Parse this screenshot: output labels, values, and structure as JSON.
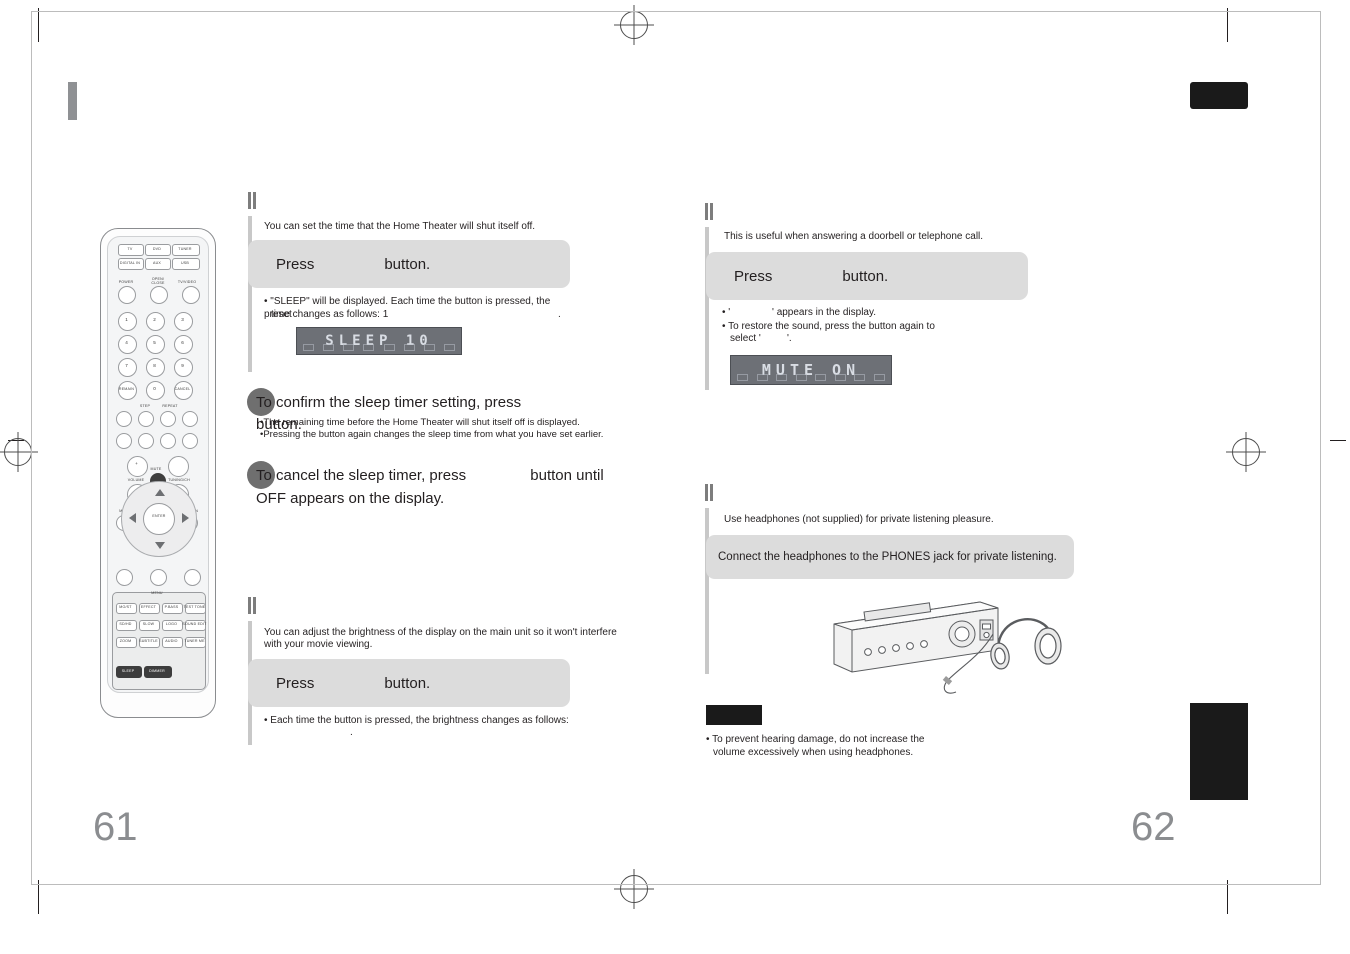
{
  "meta": {
    "left_page_number": "61",
    "right_page_number": "62"
  },
  "left_page": {
    "sleep_timer": {
      "intro": "You can set the time that the Home Theater will shut itself off.",
      "bar": {
        "press": "Press",
        "button": "button."
      },
      "bullets": [
        "• \"SLEEP\" will be displayed. Each time the button is pressed, the preset",
        "time changes as follows: 1",
        "."
      ],
      "display": {
        "text": "SLEEP 10"
      },
      "steps": [
        {
          "line1": "To confirm the sleep timer setting, press",
          "line2": "button.",
          "notes": [
            "•The remaining time before the Home Theater will shut itself off is displayed.",
            "•Pressing the button again changes the sleep time from what you have set earlier."
          ]
        },
        {
          "line1": "To cancel the sleep timer, press",
          "line2": "button until",
          "line3": "OFF appears on the display."
        }
      ]
    },
    "brightness": {
      "intro_line1": "You can adjust the brightness of the display on the main unit so it won't interfere",
      "intro_line2": "with your movie viewing.",
      "bar": {
        "press": "Press",
        "button": "button."
      },
      "bullet_line1": "• Each time the button is pressed, the brightness changes as follows:",
      "bullet_line2": "."
    }
  },
  "right_page": {
    "mute": {
      "intro": "This is useful when answering a doorbell or telephone call.",
      "bar": {
        "press": "Press",
        "button": "button."
      },
      "bullets": [
        "• '",
        "' appears in the display.",
        "• To restore the sound, press the button again to",
        "select '",
        "'."
      ],
      "display": {
        "text": "MUTE ON"
      }
    },
    "headphones": {
      "intro": "Use headphones (not supplied) for private listening pleasure.",
      "bar_text": "Connect the headphones to the PHONES jack for private listening.",
      "caution_bullet_line1": "• To prevent hearing damage, do not increase the",
      "caution_bullet_line2": "volume excessively when using headphones."
    }
  },
  "remote": {
    "source_buttons": [
      "TV",
      "DVD",
      "TUNER",
      "DIGITAL IN",
      "AUX",
      "USB"
    ],
    "power_row": [
      "POWER",
      "OPEN/ CLOSE",
      "TV/VIDEO"
    ],
    "numbers": [
      "1",
      "2",
      "3",
      "4",
      "5",
      "6",
      "7",
      "8",
      "9",
      "REMAIN",
      "0",
      "CANCEL"
    ],
    "transport_labels": [
      "STEP",
      "REPEAT"
    ],
    "volume_label": "VOLUME",
    "mute_label": "MUTE",
    "tuning_label": "TUNING/CH",
    "menu_label": "MENU",
    "return_label": "RETURN",
    "enter_label": "ENTER",
    "bottom_labels": [
      "MO/ST",
      "EFFECT",
      "P.BASS",
      "TEST TONE",
      "SD/HD",
      "SLOW",
      "LOGO",
      "SOUND EDIT",
      "ZOOM",
      "SUBTITLE",
      "AUDIO",
      "TUNER MEMORY",
      "SLEEP",
      "DIMMER"
    ]
  },
  "colors": {
    "bar_bg": "#dcdcdc",
    "circle": "#6f6f6f",
    "vfd_bg": "#6d7076",
    "vfd_text": "#d9dde4",
    "tick": "#7d7d7d",
    "pagenum": "#8b8d90",
    "black": "#1a1a1a"
  }
}
